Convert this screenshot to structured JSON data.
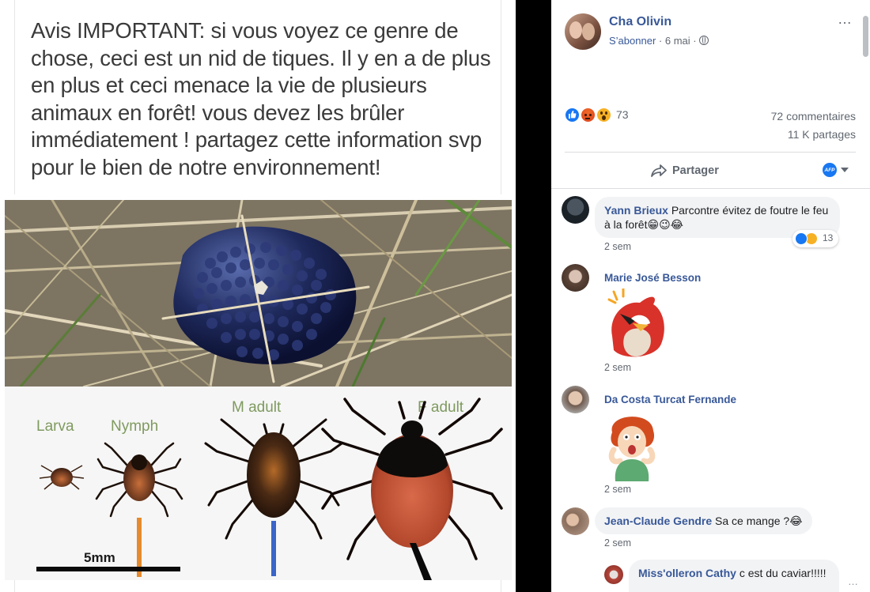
{
  "post_image": {
    "text": "Avis IMPORTANT: si vous voyez ce genre de chose, ceci est un nid de tiques. Il y en a de plus en plus et ceci menace la vie de plusieurs animaux en forêt! vous devez les brûler immédiatement ! partagez cette information svp pour le bien de notre environnement!",
    "stage_labels": [
      "Larva",
      "Nymph",
      "M adult",
      "F adult"
    ],
    "scale_label": "5mm"
  },
  "post": {
    "author": "Cha Olivin",
    "follow_label": "S’abonner",
    "date": "6 mai",
    "separator": "·",
    "more_icon": "…",
    "reaction_count": "73",
    "comments_count": "72 commentaires",
    "shares_count": "11 K partages",
    "share_label": "Partager",
    "page_badge": "AFP"
  },
  "comments": [
    {
      "author": "Yann Brieux",
      "text": "Parcontre évitez de foutre le feu à la forêt",
      "emoji": "😁😉😂",
      "reaction_count": "13",
      "time": "2 sem"
    },
    {
      "author": "Marie José Besson",
      "text": "",
      "time": "2 sem"
    },
    {
      "author": "Da Costa Turcat Fernande",
      "text": "",
      "time": "2 sem"
    },
    {
      "author": "Jean-Claude Gendre",
      "text": "Sa ce mange ?",
      "emoji": "😂",
      "time": "2 sem"
    },
    {
      "author": "Miss'olleron Cathy",
      "text": "c est du caviar!!!!!",
      "time": ""
    }
  ],
  "colors": {
    "link_blue": "#385898",
    "like_blue": "#1877f2",
    "angry_red": "#e9710f",
    "wow_yellow": "#f7b125",
    "bubble_gray": "#f2f3f5"
  }
}
